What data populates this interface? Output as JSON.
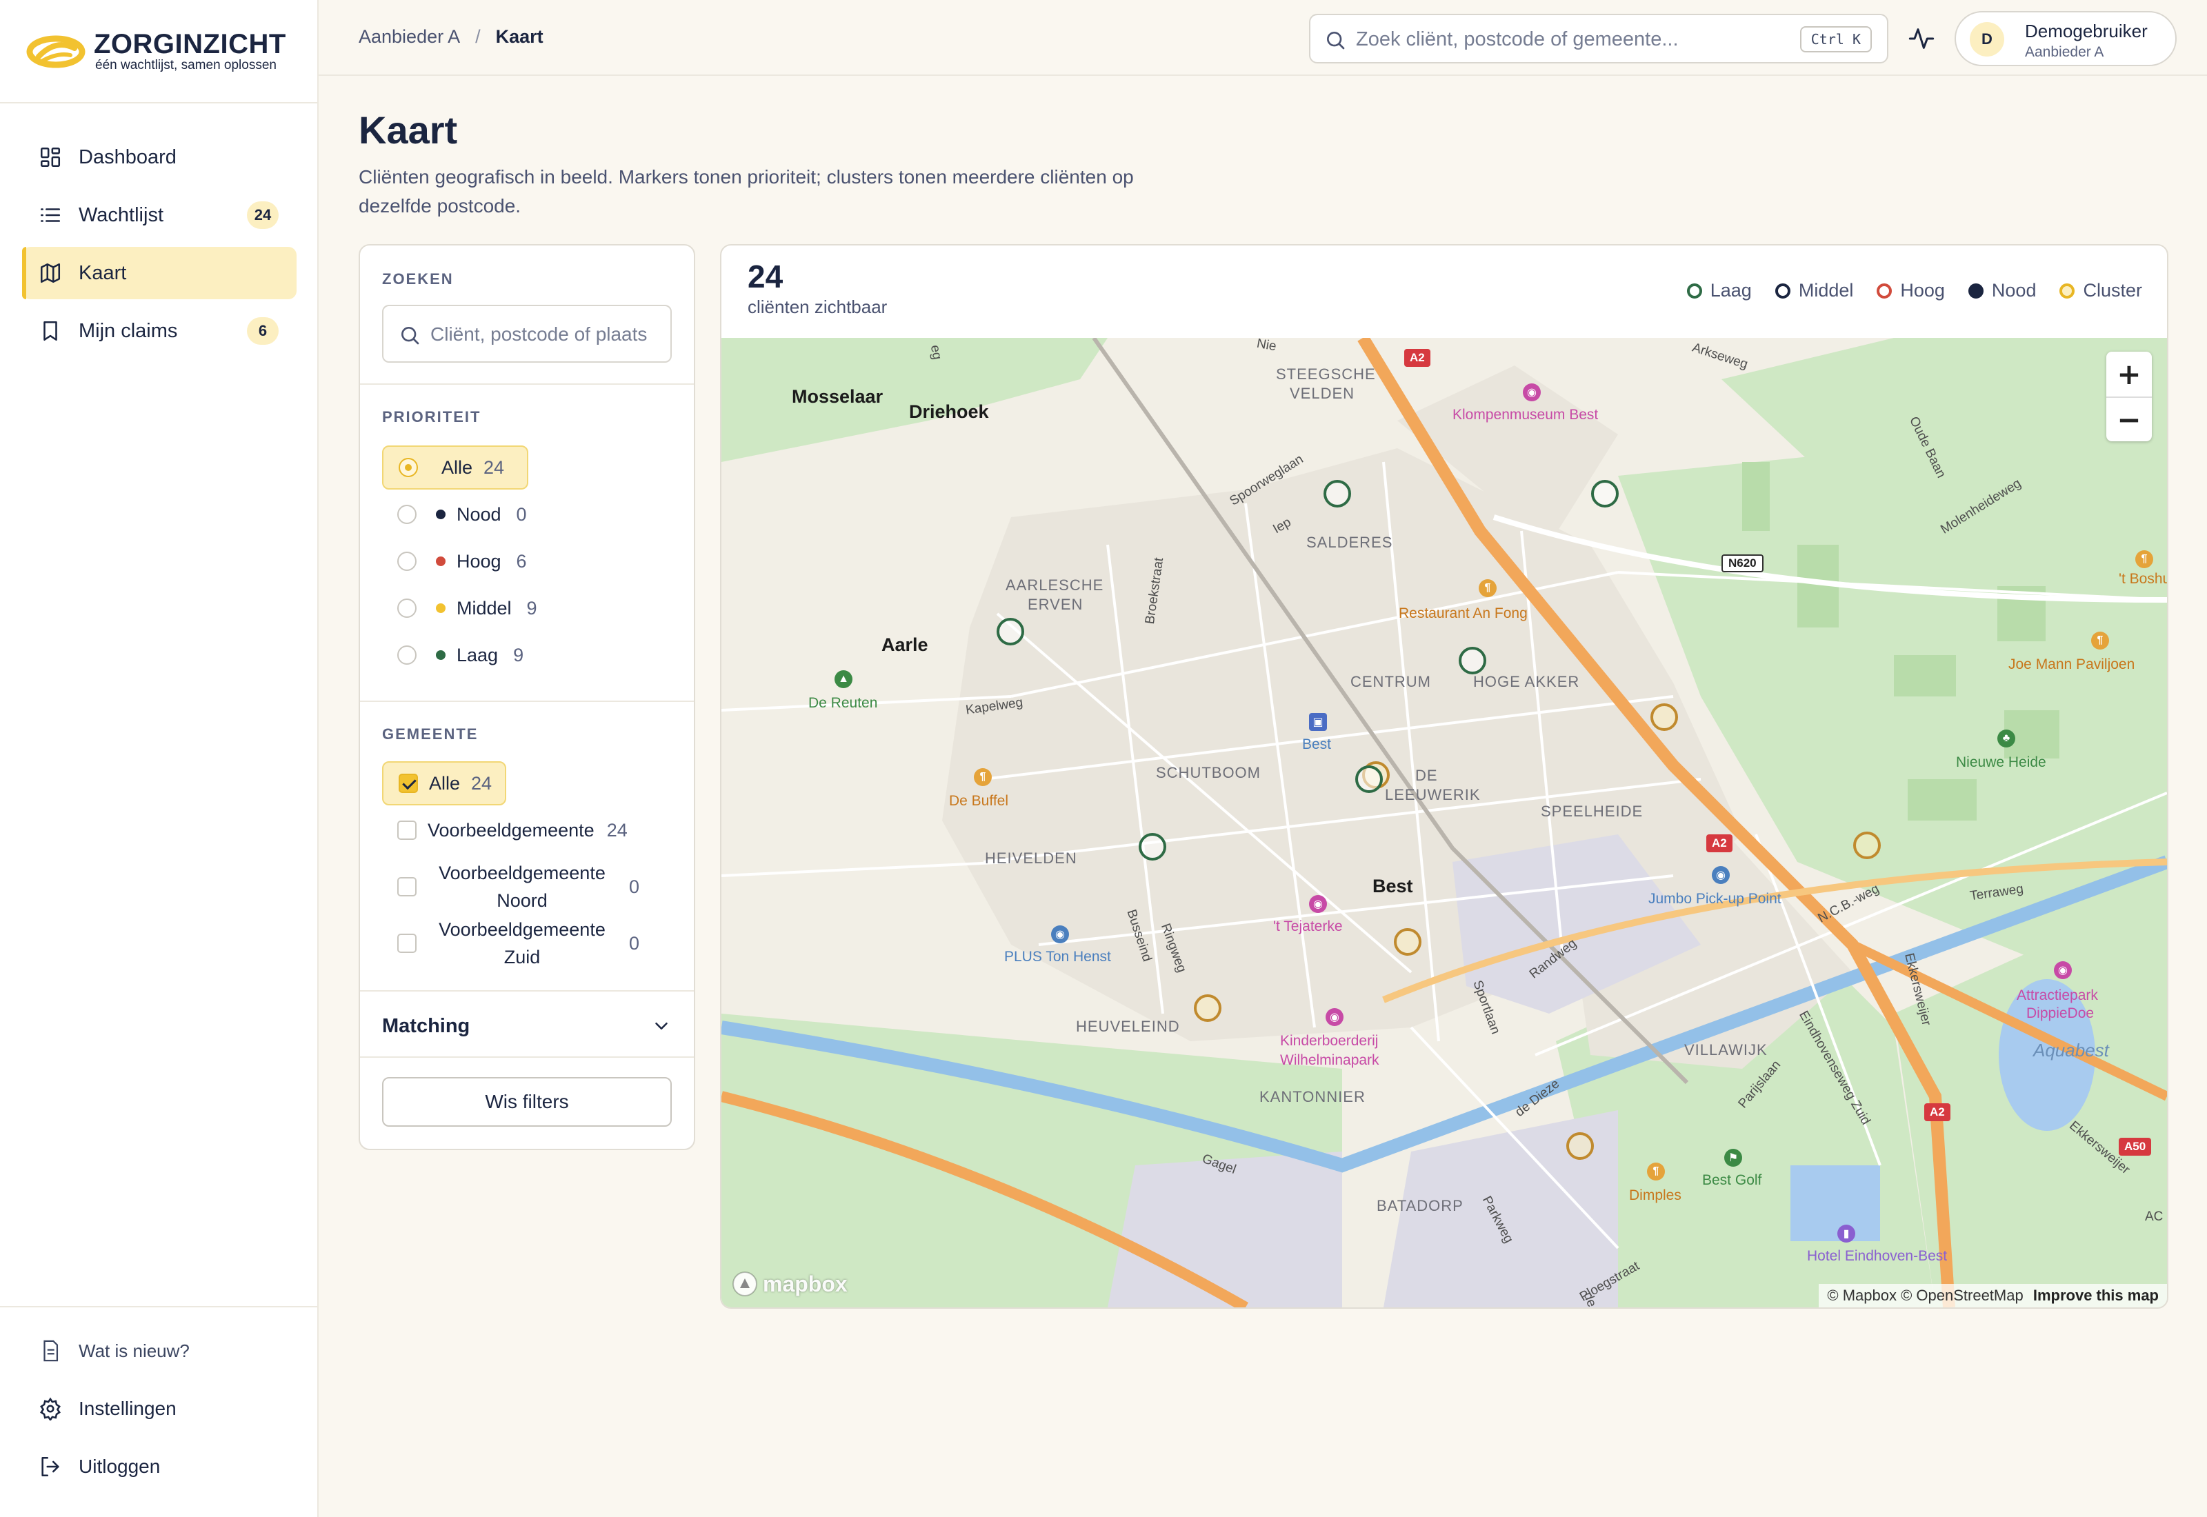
{
  "brand": {
    "name": "ZORGINZICHT",
    "tagline": "één wachtlijst, samen oplossen"
  },
  "nav": [
    {
      "label": "Dashboard",
      "icon": "dashboard-icon",
      "badge": ""
    },
    {
      "label": "Wachtlijst",
      "icon": "list-icon",
      "badge": "24"
    },
    {
      "label": "Kaart",
      "icon": "map-icon",
      "badge": "",
      "active": true
    },
    {
      "label": "Mijn claims",
      "icon": "bookmark-icon",
      "badge": "6"
    }
  ],
  "sidebar_bottom": {
    "whats_new": "Wat is nieuw?",
    "settings": "Instellingen",
    "logout": "Uitloggen"
  },
  "breadcrumb": {
    "parent": "Aanbieder A",
    "separator": "/",
    "current": "Kaart"
  },
  "search": {
    "placeholder": "Zoek cliënt, postcode of gemeente...",
    "shortcut": "Ctrl K"
  },
  "user": {
    "initial": "D",
    "name": "Demogebruiker",
    "role": "Aanbieder A"
  },
  "page": {
    "title": "Kaart",
    "subtitle": "Cliënten geografisch in beeld. Markers tonen prioriteit; clusters tonen meerdere cliënten op dezelfde postcode."
  },
  "filters": {
    "search_title": "ZOEKEN",
    "search_placeholder": "Cliënt, postcode of plaats",
    "priority_title": "PRIORITEIT",
    "priority": [
      {
        "label": "Alle",
        "count": "24",
        "color": "",
        "selected": true
      },
      {
        "label": "Nood",
        "count": "0",
        "color": "#1b2540"
      },
      {
        "label": "Hoog",
        "count": "6",
        "color": "#d14b3c"
      },
      {
        "label": "Middel",
        "count": "9",
        "color": "#f2c230"
      },
      {
        "label": "Laag",
        "count": "9",
        "color": "#2e6b45"
      }
    ],
    "municipality_title": "GEMEENTE",
    "municipalities": [
      {
        "label": "Alle",
        "count": "24",
        "checked": true
      },
      {
        "label": "Voorbeeldgemeente",
        "count": "24"
      },
      {
        "label": "Voorbeeldgemeente Noord",
        "count": "0"
      },
      {
        "label": "Voorbeeldgemeente Zuid",
        "count": "0"
      }
    ],
    "matching_label": "Matching",
    "clear_label": "Wis filters"
  },
  "map": {
    "count": "24",
    "count_label": "cliënten zichtbaar",
    "legend": [
      {
        "label": "Laag",
        "color": "#2e6b45",
        "fill": "#ffffff"
      },
      {
        "label": "Middel",
        "color": "#1b2540",
        "fill": "#ffffff"
      },
      {
        "label": "Hoog",
        "color": "#d14b3c",
        "fill": "#ffffff"
      },
      {
        "label": "Nood",
        "color": "#1b2540",
        "fill": "#1b2540"
      },
      {
        "label": "Cluster",
        "color": "#e8b624",
        "fill": "#fcefc1"
      }
    ],
    "labels": {
      "mosselaar": "Mosselaar",
      "driehoek": "Driehoek",
      "aarle": "Aarle",
      "de_reuten": "De Reuten",
      "aarlesche": "AARLESCHE",
      "erven": "ERVEN",
      "steegsche": "STEEGSCHE",
      "velden": "VELDEN",
      "klompenmuseum": "Klompenmuseum Best",
      "salderes": "SALDERES",
      "restaurant": "Restaurant An Fong",
      "centrum": "CENTRUM",
      "hoge_akker": "HOGE AKKER",
      "best_station": "Best",
      "schutboom": "SCHUTBOOM",
      "de": "DE",
      "leeuwerik": "LEEUWERIK",
      "speelheide": "SPEELHEIDE",
      "de_buffel": "De Buffel",
      "heivelden": "HEIVELDEN",
      "best": "Best",
      "tejaterke": "'t Tejaterke",
      "plus": "PLUS Ton Henst",
      "heuveleind": "HEUVELEIND",
      "kinderboerderij": "Kinderboerderij",
      "wilhelminapark": "Wilhelminapark",
      "kantonnier": "KANTONNIER",
      "batadorp": "BATADORP",
      "jumbo": "Jumbo Pick-up Point",
      "villawijk": "VILLAWIJK",
      "dimples": "Dimples",
      "best_golf": "Best Golf",
      "hotel": "Hotel Eindhoven-Best",
      "attractiepark": "Attractiepark",
      "dippiedoe": "DippieDoe",
      "aquabest": "Aquabest",
      "nieuwe_heide": "Nieuwe Heide",
      "joe_mann": "Joe Mann Paviljoen",
      "boshuys": "'t Boshuys",
      "spoorweglaan": "Spoorweglaan",
      "iep": "Iep",
      "broekstraat": "Broekstraat",
      "kapelweg": "Kapelweg",
      "ringweg": "Ringweg",
      "busseind": "Busseind",
      "sportlaan": "Sportlaan",
      "randweg": "Randweg",
      "de_dieze": "de Dieze",
      "gagel": "Gagel",
      "parkweg": "Parkweg",
      "ploegstraat": "Ploegstraat",
      "parijslaan": "Parijslaan",
      "eindhovenseweg": "Eindhovenseweg Zuid",
      "ncb": "N.C.B.-weg",
      "terraweg": "Terraweg",
      "ekkersweijer": "Ekkersweijer",
      "ekkersweijer2": "Ekkersweijer",
      "oude_baan": "Oude Baan",
      "molenheideweg": "Molenheideweg",
      "arkseweg": "Arkseweg",
      "nie": "Nie",
      "ac": "AC",
      "eg": "eg",
      "de_small": "de"
    },
    "shields": {
      "a2_top": "A2",
      "a2_mid": "A2",
      "a2_low": "A2",
      "n620": "N620",
      "a50": "A50"
    },
    "zoom_in": "+",
    "zoom_out": "−",
    "mapbox": "mapbox",
    "attribution": "© Mapbox © OpenStreetMap",
    "improve": "Improve this map"
  }
}
